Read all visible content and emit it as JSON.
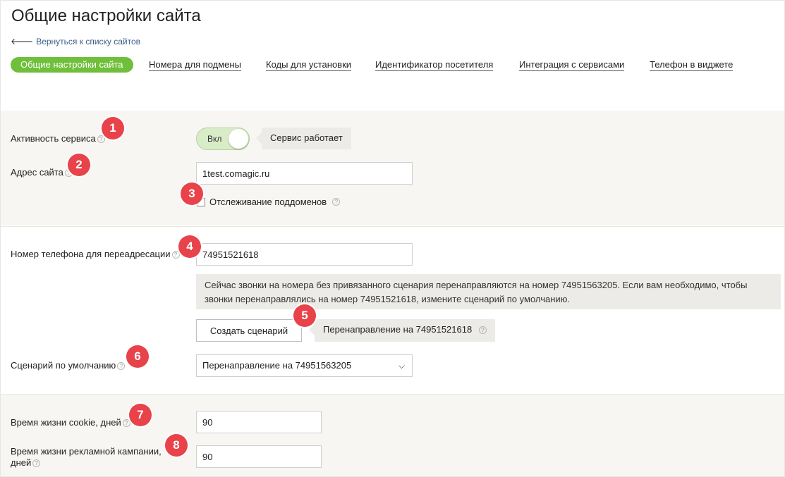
{
  "page": {
    "title": "Общие настройки сайта",
    "back_link": "Вернуться к списку сайтов"
  },
  "tabs": [
    {
      "label": "Общие настройки сайта",
      "active": true
    },
    {
      "label": "Номера для подмены",
      "active": false
    },
    {
      "label": "Коды для установки",
      "active": false
    },
    {
      "label": "Идентификатор посетителя",
      "active": false
    },
    {
      "label": "Интеграция с сервисами",
      "active": false
    },
    {
      "label": "Телефон в виджете",
      "active": false
    }
  ],
  "service": {
    "label": "Активность сервиса",
    "toggle_label": "Вкл",
    "status": "Сервис работает"
  },
  "site": {
    "label": "Адрес сайта",
    "value": "1test.comagic.ru",
    "subdomain_label": "Отслеживание поддоменов",
    "subdomain_checked": true
  },
  "redirect": {
    "label": "Номер телефона для переадресации",
    "value": "74951521618",
    "notice": "Сейчас звонки на номера без привязанного сценария перенаправляются на номер 74951563205. Если вам необходимо, чтобы звонки перенаправлялись на номер 74951521618, измените сценарий по умолчанию.",
    "create_button": "Создать сценарий",
    "redirect_tip": "Перенаправление на 74951521618"
  },
  "default_scenario": {
    "label": "Сценарий по умолчанию",
    "selected": "Перенаправление на 74951563205"
  },
  "cookie": {
    "label": "Время жизни cookie, дней",
    "value": "90"
  },
  "campaign": {
    "label": "Время жизни рекламной кампании, дней",
    "value": "90"
  },
  "badges": [
    "1",
    "2",
    "3",
    "4",
    "5",
    "6",
    "7",
    "8"
  ],
  "colors": {
    "accent_green": "#6fbf3b",
    "badge_red": "#e8424a",
    "link_blue": "#3a5d87"
  },
  "icons": {
    "help": "?",
    "back": "🡐",
    "check": "✔",
    "chevron": "⌵"
  }
}
